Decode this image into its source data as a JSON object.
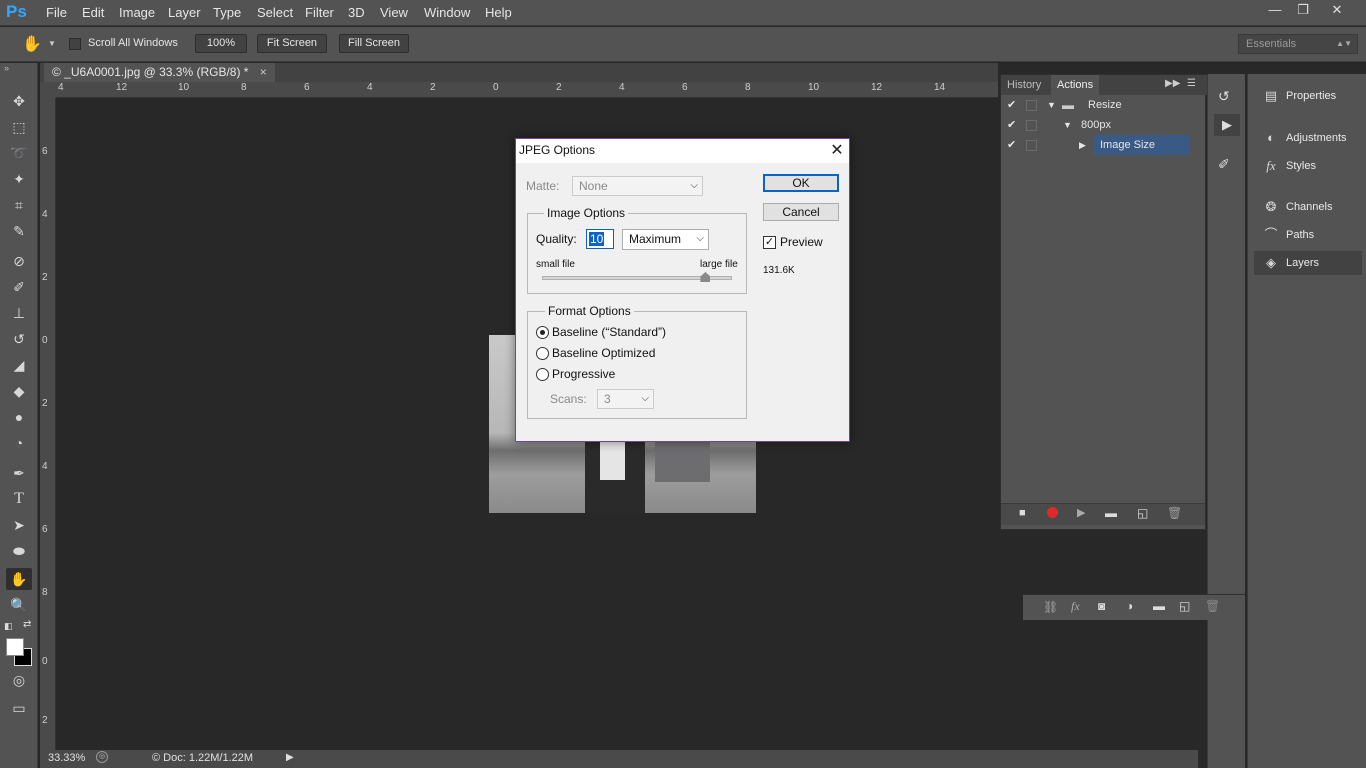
{
  "app": {
    "logo": "Ps"
  },
  "menu": [
    "File",
    "Edit",
    "Image",
    "Layer",
    "Type",
    "Select",
    "Filter",
    "3D",
    "View",
    "Window",
    "Help"
  ],
  "window_controls": {
    "minimize": "—",
    "restore": "❐",
    "close": "✕"
  },
  "options_bar": {
    "scroll_all_windows": "Scroll All Windows",
    "zoom_100": "100%",
    "fit_screen": "Fit Screen",
    "fill_screen": "Fill Screen",
    "workspace": "Essentials"
  },
  "document": {
    "tab_title": "© _U6A0001.jpg @ 33.3% (RGB/8) *",
    "tab_close": "×",
    "ruler_top": [
      "4",
      "12",
      "10",
      "8",
      "6",
      "4",
      "2",
      "0",
      "2",
      "4",
      "6",
      "8",
      "10",
      "12",
      "14"
    ],
    "ruler_left": [
      "6",
      "4",
      "2",
      "0",
      "2",
      "4",
      "6",
      "8",
      "0",
      "2"
    ]
  },
  "status": {
    "zoom": "33.33%",
    "doc_info": "© Doc: 1.22M/1.22M"
  },
  "actions_panel": {
    "tabs": [
      "History",
      "Actions"
    ],
    "active_tab": "Actions",
    "rows": [
      {
        "label": "Resize",
        "level": 0
      },
      {
        "label": "800px",
        "level": 1
      },
      {
        "label": "Image Size",
        "level": 2
      }
    ]
  },
  "right_panel": {
    "items": [
      {
        "label": "Properties",
        "icon": "properties-icon"
      },
      {
        "label": "Adjustments",
        "icon": "adjustments-icon"
      },
      {
        "label": "Styles",
        "icon": "styles-icon"
      },
      {
        "label": "Channels",
        "icon": "channels-icon"
      },
      {
        "label": "Paths",
        "icon": "paths-icon"
      },
      {
        "label": "Layers",
        "icon": "layers-icon"
      }
    ]
  },
  "dialog": {
    "title": "JPEG Options",
    "matte_label": "Matte:",
    "matte_value": "None",
    "image_options_title": "Image Options",
    "quality_label": "Quality:",
    "quality_value": "10",
    "quality_preset": "Maximum",
    "small_file": "small file",
    "large_file": "large file",
    "quality_slider_fraction": 0.86,
    "format_options_title": "Format Options",
    "format_options": [
      "Baseline (“Standard”)",
      "Baseline Optimized",
      "Progressive"
    ],
    "selected_format": 0,
    "scans_label": "Scans:",
    "scans_value": "3",
    "ok": "OK",
    "cancel": "Cancel",
    "preview_label": "Preview",
    "preview_checked": true,
    "file_size": "131.6K"
  }
}
